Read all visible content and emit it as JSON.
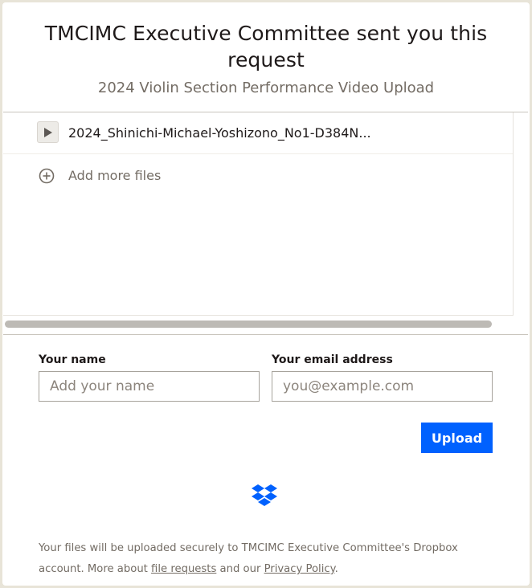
{
  "header": {
    "title": "TMCIMC Executive Committee sent you this request",
    "subtitle": "2024 Violin Section Performance Video Upload"
  },
  "files": {
    "items": [
      {
        "name": "2024_Shinichi-Michael-Yoshizono_No1-D384N...",
        "icon": "play-icon"
      }
    ],
    "add_more_label": "Add more files"
  },
  "form": {
    "name_label": "Your name",
    "name_placeholder": "Add your name",
    "name_value": "",
    "email_label": "Your email address",
    "email_placeholder": "you@example.com",
    "email_value": "",
    "upload_label": "Upload"
  },
  "footer": {
    "text_before": "Your files will be uploaded securely to TMCIMC Executive Committee's Dropbox account. More about ",
    "file_requests_link": "file requests",
    "text_middle": " and our ",
    "privacy_link": "Privacy Policy",
    "text_after": "."
  },
  "colors": {
    "accent": "#0061fe",
    "text_primary": "#1e1919",
    "text_secondary": "#736c64",
    "page_border": "#e8e4d8"
  }
}
